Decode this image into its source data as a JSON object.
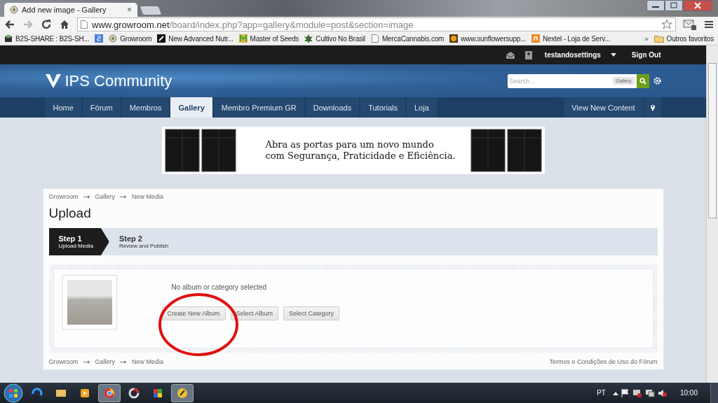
{
  "browser": {
    "tab_title": "Add new image - Gallery",
    "close": "×",
    "url_host": "www.growroom.net",
    "url_path": "/board/index.php?app=gallery&module=post&section=image",
    "bookmarks": [
      {
        "kind": "link",
        "label": "B2S-SHARE : B2S-SH..."
      },
      {
        "kind": "icon"
      },
      {
        "kind": "link",
        "label": "Growroom"
      },
      {
        "kind": "link",
        "label": "New Advanced Nutr..."
      },
      {
        "kind": "link",
        "label": "Master of Seeds"
      },
      {
        "kind": "link",
        "label": "Cultivo No Brasil"
      },
      {
        "kind": "link",
        "label": "MercaCannabis.com"
      },
      {
        "kind": "link",
        "label": "www.sunflowersupp..."
      },
      {
        "kind": "link",
        "label": "Nextel - Loja de Serv..."
      }
    ],
    "overflow": "»",
    "other_bookmarks": "Outros favoritos"
  },
  "user_bar": {
    "username": "testandosettings",
    "sign_out": "Sign Out"
  },
  "header": {
    "logo": "IPS Community",
    "search": {
      "placeholder": "Search...",
      "scope": "Gallery"
    }
  },
  "nav": {
    "items": [
      {
        "label": "Home",
        "selected": false
      },
      {
        "label": "Fórum",
        "selected": false
      },
      {
        "label": "Membros",
        "selected": false
      },
      {
        "label": "Gallery",
        "selected": true
      },
      {
        "label": "Membro Premium GR",
        "selected": false
      },
      {
        "label": "Downloads",
        "selected": false
      },
      {
        "label": "Tutorials",
        "selected": false
      },
      {
        "label": "Loja",
        "selected": false
      }
    ],
    "right": "View New Content"
  },
  "banner": {
    "lines": [
      "Abra as portas para um novo mundo",
      "com Segurança, Praticidade e Eficiência."
    ]
  },
  "breadcrumbs": [
    "Growroom",
    "Gallery",
    "New Media"
  ],
  "title": "Upload",
  "steps": [
    {
      "title": "Step 1",
      "subtitle": "Upload Media",
      "selected": true
    },
    {
      "title": "Step 2",
      "subtitle": "Review and Publish",
      "selected": false
    }
  ],
  "upload": {
    "message": "No album or category selected",
    "buttons": [
      "Create New Album",
      "Select Album",
      "Select Category"
    ]
  },
  "footer": {
    "breadcrumbs": [
      "Growroom",
      "Gallery",
      "New Media"
    ],
    "terms": "Termos e Condições de Uso do Fórum"
  },
  "taskbar": {
    "language": "PT",
    "time": "10:00"
  }
}
